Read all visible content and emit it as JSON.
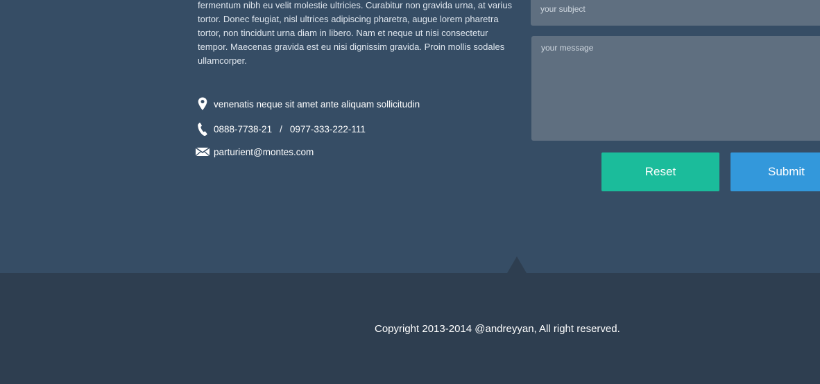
{
  "about": {
    "text": "fermentum nibh eu velit molestie ultricies. Curabitur non gravida urna, at varius tortor. Donec feugiat, nisl ultrices adipiscing pharetra, augue lorem pharetra tortor, non tincidunt urna diam in libero. Nam et neque ut nisi consectetur tempor. Maecenas gravida est eu nisi dignissim gravida. Proin mollis sodales ullamcorper."
  },
  "contact": {
    "address": "venenatis neque sit amet ante aliquam sollicitudin",
    "phone_1": "0888-7738-21",
    "phone_separator": "/",
    "phone_2": "0977-333-222-111",
    "email": "parturient@montes.com",
    "icons": {
      "address": "map-pin-icon",
      "phone": "phone-icon",
      "email": "envelope-icon"
    }
  },
  "form": {
    "subject_placeholder": "your subject",
    "message_placeholder": "your message",
    "reset_label": "Reset",
    "submit_label": "Submit",
    "colors": {
      "reset": "#1bbc9b",
      "submit": "#3398db",
      "field": "#5f6f80"
    }
  },
  "footer": {
    "copyright": "Copyright 2013-2014 @andreyyan, All right reserved."
  },
  "colors": {
    "section_bg": "#364d65",
    "footer_bg": "#2e3e50"
  }
}
